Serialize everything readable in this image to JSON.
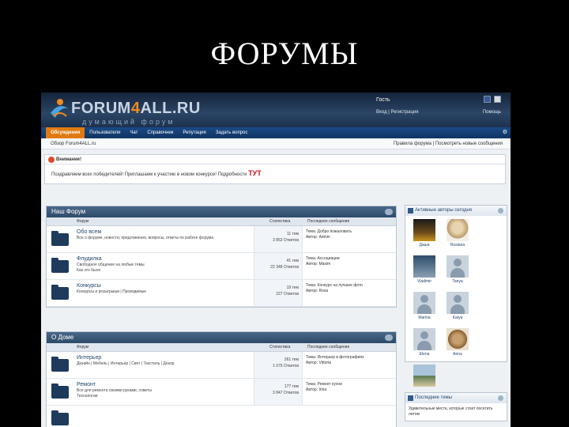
{
  "slide": {
    "title": "ФОРУМЫ"
  },
  "header": {
    "logo_name_a": "FORUM",
    "logo_name_4": "4",
    "logo_name_b": "ALL.RU",
    "tagline": "думающий форум",
    "guest": "Гость",
    "welcome": "Вход | Регистрация",
    "help": "Помощь"
  },
  "nav": {
    "tabs": [
      "Обсуждения",
      "Пользователи",
      "Чат",
      "Справочник",
      "Репутация",
      "Задать вопрос"
    ],
    "tools": "⚙"
  },
  "crumbs": {
    "left": "Обзор Forum4ALL.ru",
    "right": "Правила форума | Посмотреть новые сообщения"
  },
  "notice": {
    "title": "Внимание!",
    "text": "Поздравляем всех победителей! Приглашаем к участию в новом конкурсе! Подробности",
    "link": "ТУТ"
  },
  "categories": [
    {
      "title": "Наш Форум",
      "cols": {
        "forum": "Форум",
        "stats": "Статистика",
        "last": "Последнее сообщение"
      },
      "rows": [
        {
          "title": "Обо всем",
          "desc": "Все о форуме, новости, предложения, вопросы, ответы по работе форума",
          "stats": "11 тем\n3 852 Ответов",
          "last": "Тема: Добро пожаловать\nАвтор: Admin"
        },
        {
          "title": "Флудилка",
          "desc": "Свободное общение на любые темы\nКак это было",
          "stats": "41 тем\n22 348 Ответов",
          "last": "Тема: Ассоциации\nАвтор: Maxim"
        },
        {
          "title": "Конкурсы",
          "desc": "Конкурсы и розыгрыши | Проводимые",
          "stats": "19 тем\n227 Ответов",
          "last": "Тема: Конкурс на лучшее фото\nАвтор: Rosa"
        }
      ]
    },
    {
      "title": "О Доме",
      "cols": {
        "forum": "Форум",
        "stats": "Статистика",
        "last": "Последнее сообщение"
      },
      "rows": [
        {
          "title": "Интерьер",
          "desc": "Дизайн | Мебель | Интерьер | Свет | Текстиль | Декор",
          "stats": "261 тем\n1 076 Ответов",
          "last": "Тема: Интерьер в фотографиях\nАвтор: Vittoria"
        },
        {
          "title": "Ремонт",
          "desc": "Все для ремонта своими руками, советы\nТехнологии",
          "stats": "177 тем\n3 847 Ответов",
          "last": "Тема: Ремонт кухни\nАвтор: Irina"
        },
        {
          "title": "",
          "desc": "",
          "stats": "",
          "last": ""
        }
      ]
    }
  ],
  "sidebar": {
    "active_users_title": "Активные авторы сегодня",
    "users": [
      "Даша",
      "Ruslana",
      "Vladimir",
      "Tanya",
      "Marina",
      "Katya",
      "Elena",
      "Anna"
    ],
    "latest_title": "Последние темы",
    "latest_text": "Удивительные места, которые стоит посетить летом"
  }
}
